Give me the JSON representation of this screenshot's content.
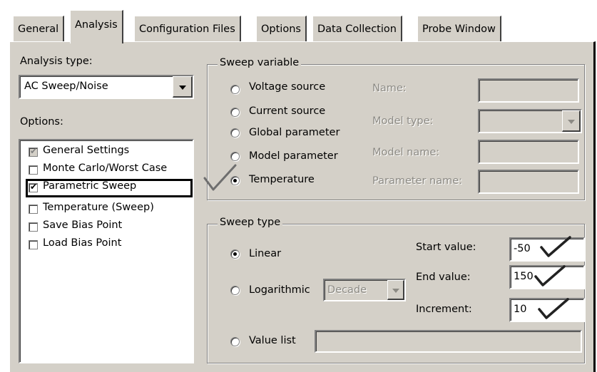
{
  "tabs": [
    "General",
    "Analysis",
    "Configuration Files",
    "Options",
    "Data Collection",
    "Probe Window"
  ],
  "analysis_type": {
    "label": "Analysis type:",
    "value": "AC Sweep/Noise"
  },
  "options": {
    "label": "Options:",
    "items": [
      {
        "label": "General Settings",
        "checked": true,
        "disabled": true
      },
      {
        "label": "Monte Carlo/Worst Case",
        "checked": false
      },
      {
        "label": "Parametric Sweep",
        "checked": true,
        "highlighted": true
      },
      {
        "label": "Temperature (Sweep)",
        "checked": false
      },
      {
        "label": "Save Bias Point",
        "checked": false
      },
      {
        "label": "Load Bias Point",
        "checked": false
      }
    ]
  },
  "sweep_variable": {
    "title": "Sweep variable",
    "options": [
      "Voltage source",
      "Current source",
      "Global parameter",
      "Model parameter",
      "Temperature"
    ],
    "selected": "Temperature",
    "fields": {
      "name": "Name:",
      "model_type": "Model type:",
      "model_name": "Model name:",
      "parameter_name": "Parameter name:"
    }
  },
  "sweep_type": {
    "title": "Sweep type",
    "options": {
      "linear": "Linear",
      "logarithmic": "Logarithmic",
      "value_list": "Value list"
    },
    "selected": "Linear",
    "log_scale": "Decade",
    "start_label": "Start value:",
    "start_value": "-50",
    "end_label": "End value:",
    "end_value": "150",
    "increment_label": "Increment:",
    "increment_value": "10"
  },
  "annotation": {
    "icon": "checkmark-icon"
  },
  "colors": {
    "dialog": "#d4d0c8",
    "disabled_text": "#8c8a84",
    "highlight_border": "#000000"
  }
}
